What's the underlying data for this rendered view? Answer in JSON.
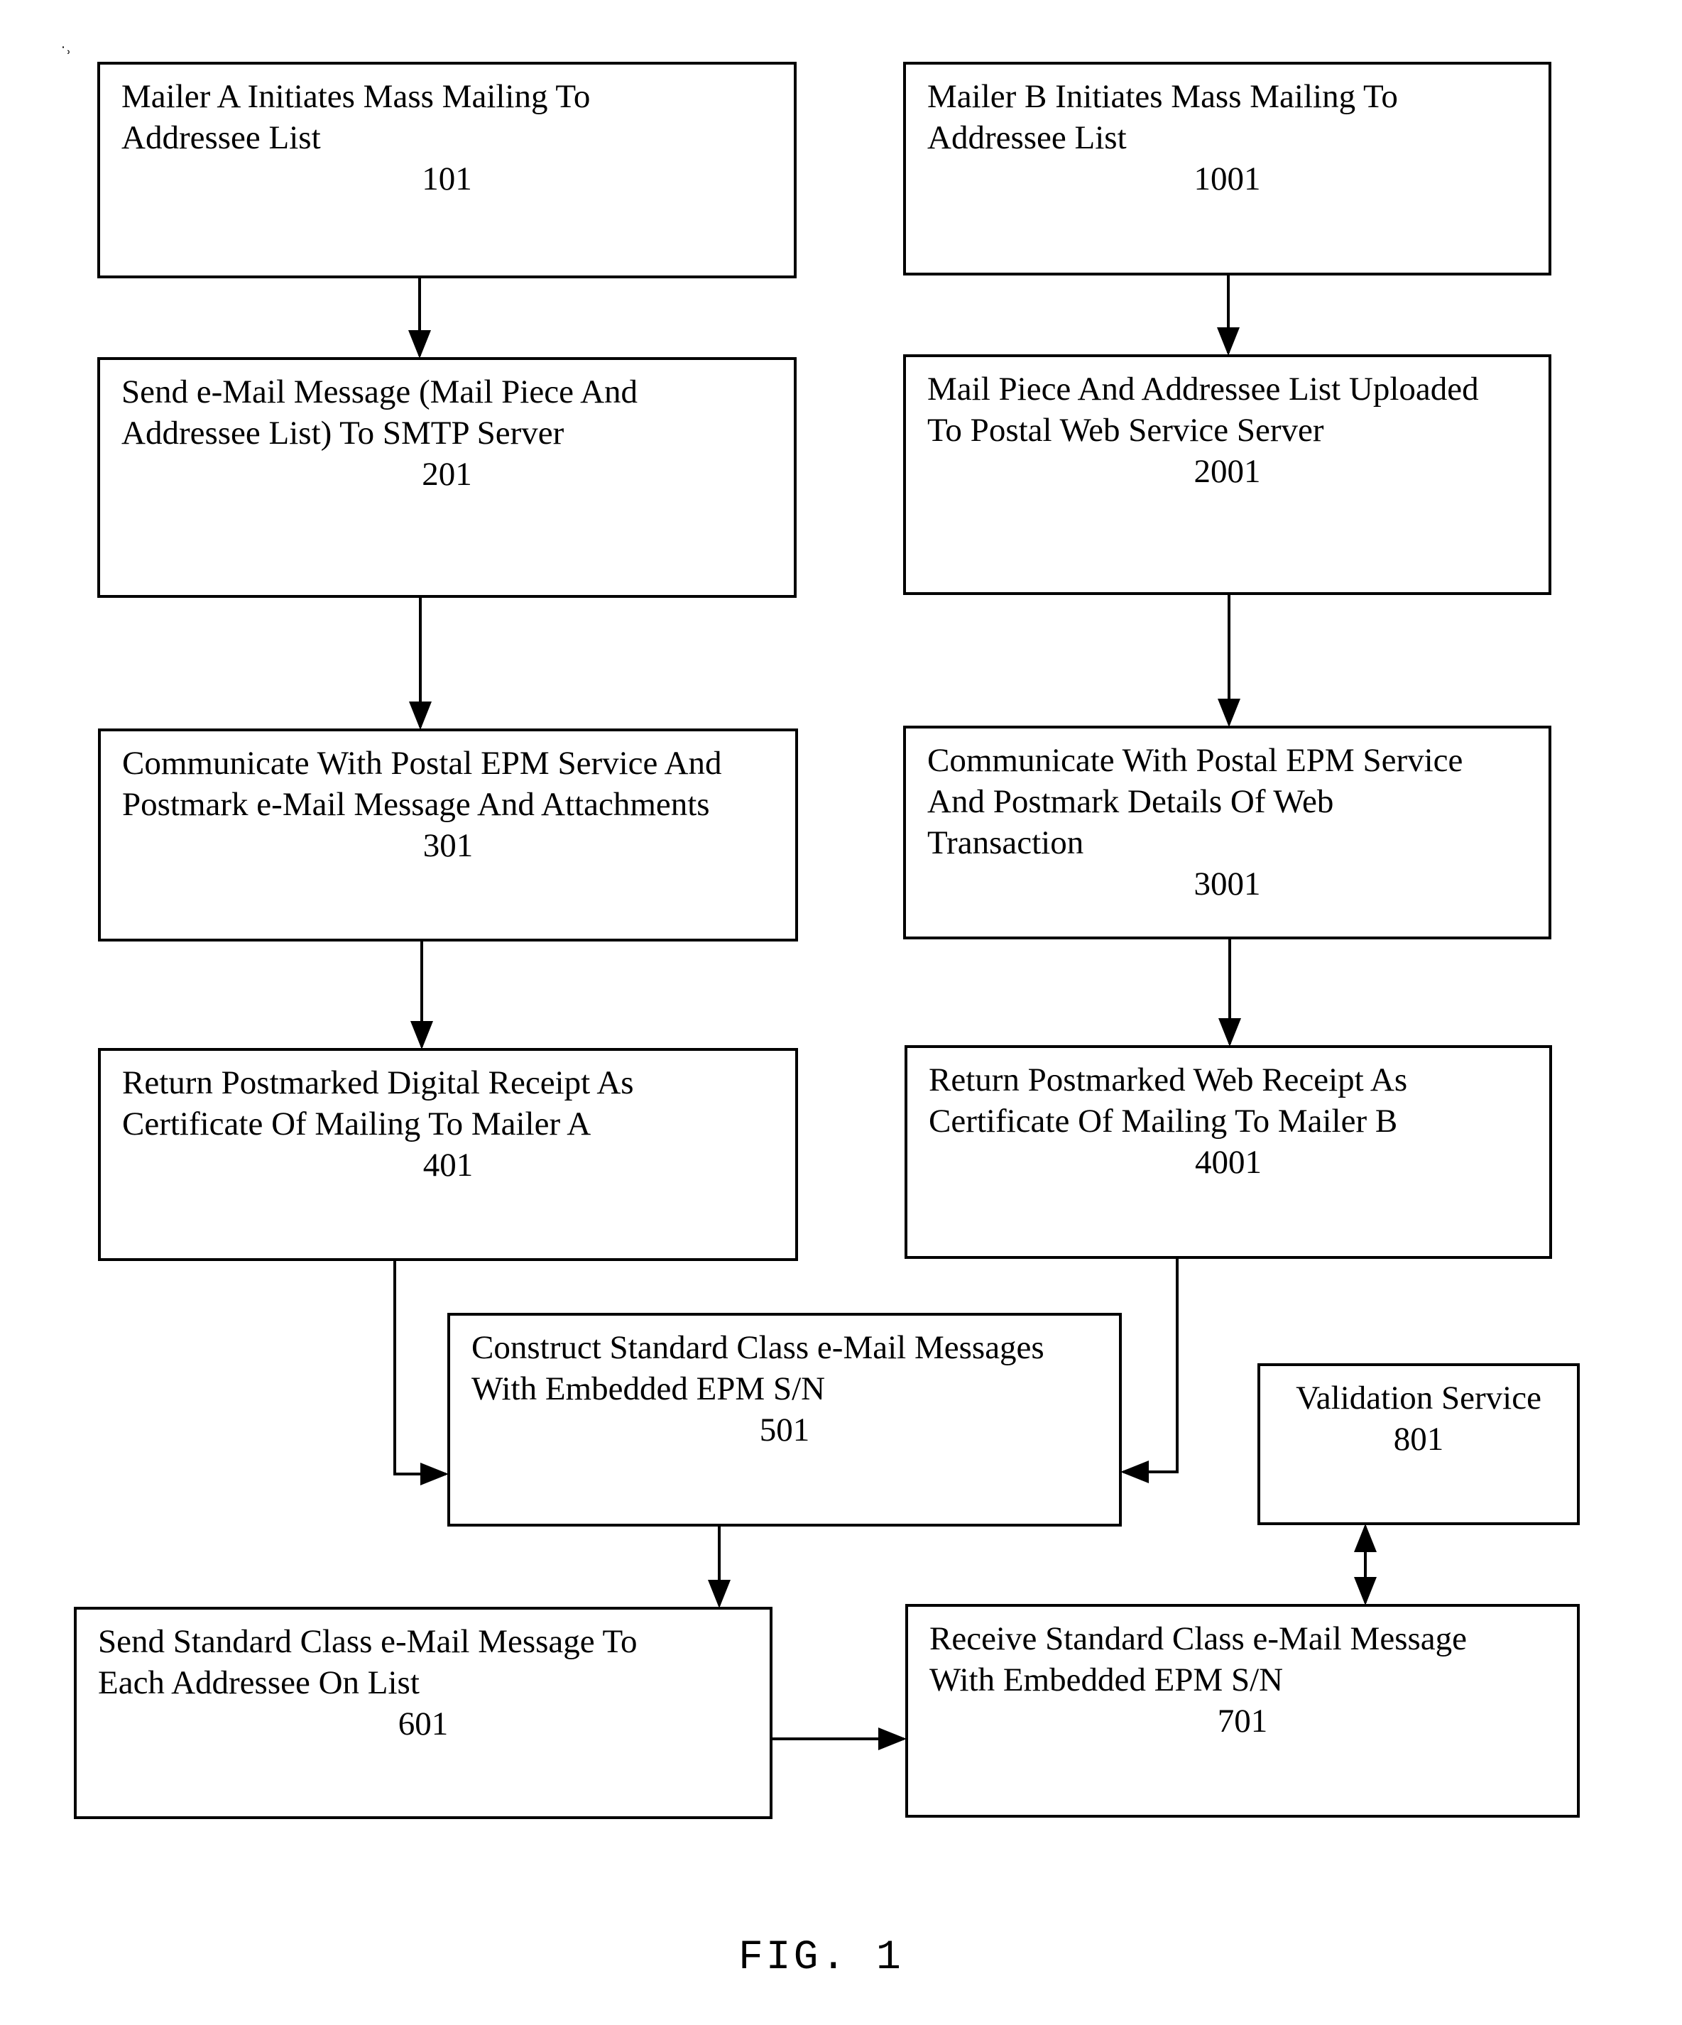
{
  "figure": {
    "caption": "FIG. 1",
    "boxes": {
      "b101": {
        "text": "Mailer A Initiates Mass Mailing To\nAddressee List",
        "ref": "101"
      },
      "b1001": {
        "text": "Mailer B Initiates Mass Mailing To\nAddressee List",
        "ref": "1001"
      },
      "b201": {
        "text": "Send e-Mail Message (Mail Piece And\nAddressee List) To SMTP Server",
        "ref": "201"
      },
      "b2001": {
        "text": "Mail Piece And Addressee List Uploaded\nTo Postal Web Service Server",
        "ref": "2001"
      },
      "b301": {
        "text": "Communicate With Postal EPM Service And\nPostmark e-Mail Message And Attachments",
        "ref": "301"
      },
      "b3001": {
        "text": "Communicate With Postal EPM Service\nAnd Postmark Details Of Web\nTransaction",
        "ref": "3001"
      },
      "b401": {
        "text": "Return Postmarked Digital Receipt  As\nCertificate Of Mailing To Mailer A",
        "ref": "401"
      },
      "b4001": {
        "text": "Return Postmarked Web Receipt As\nCertificate Of Mailing To Mailer B",
        "ref": "4001"
      },
      "b501": {
        "text": "Construct Standard Class e-Mail Messages\nWith Embedded EPM S/N",
        "ref": "501"
      },
      "b801": {
        "text": "Validation Service",
        "ref": "801"
      },
      "b601": {
        "text": "Send Standard Class e-Mail Message To\nEach Addressee On List",
        "ref": "601"
      },
      "b701": {
        "text": "Receive Standard Class e-Mail Message\nWith Embedded EPM S/N",
        "ref": "701"
      }
    },
    "edges": [
      {
        "from": "101",
        "to": "201",
        "type": "arrow"
      },
      {
        "from": "201",
        "to": "301",
        "type": "arrow"
      },
      {
        "from": "301",
        "to": "401",
        "type": "arrow"
      },
      {
        "from": "401",
        "to": "501",
        "type": "arrow"
      },
      {
        "from": "1001",
        "to": "2001",
        "type": "arrow"
      },
      {
        "from": "2001",
        "to": "3001",
        "type": "arrow"
      },
      {
        "from": "3001",
        "to": "4001",
        "type": "arrow"
      },
      {
        "from": "4001",
        "to": "501",
        "type": "arrow"
      },
      {
        "from": "501",
        "to": "601",
        "type": "arrow"
      },
      {
        "from": "601",
        "to": "701",
        "type": "arrow"
      },
      {
        "from": "801",
        "to": "701",
        "type": "bidirectional"
      }
    ]
  }
}
